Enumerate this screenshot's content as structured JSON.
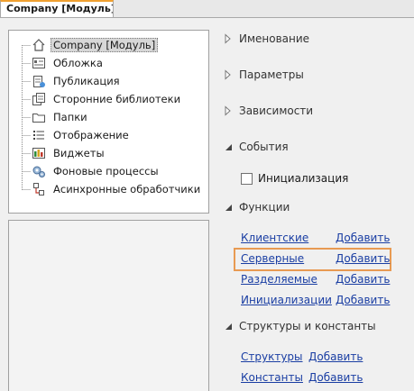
{
  "tab": {
    "label": "Company [Модуль]"
  },
  "tree": {
    "items": [
      {
        "label": "Company [Модуль]",
        "icon": "home-icon"
      },
      {
        "label": "Обложка",
        "icon": "cover-icon"
      },
      {
        "label": "Публикация",
        "icon": "publication-icon"
      },
      {
        "label": "Сторонние библиотеки",
        "icon": "libraries-icon"
      },
      {
        "label": "Папки",
        "icon": "folder-icon"
      },
      {
        "label": "Отображение",
        "icon": "list-icon"
      },
      {
        "label": "Виджеты",
        "icon": "widgets-icon"
      },
      {
        "label": "Фоновые процессы",
        "icon": "gears-icon"
      },
      {
        "label": "Асинхронные обработчики",
        "icon": "async-handlers-icon"
      }
    ]
  },
  "sections": {
    "naming": "Именование",
    "parameters": "Параметры",
    "dependencies": "Зависимости",
    "events": "События",
    "functions": "Функции",
    "structures": "Структуры и константы"
  },
  "events": {
    "initialization_label": "Инициализация"
  },
  "functions": {
    "rows": [
      {
        "name": "Клиентские",
        "add": "Добавить"
      },
      {
        "name": "Серверные",
        "add": "Добавить"
      },
      {
        "name": "Разделяемые",
        "add": "Добавить"
      },
      {
        "name": "Инициализации",
        "add": "Добавить"
      }
    ]
  },
  "structures": {
    "rows": [
      {
        "name": "Структуры",
        "add": "Добавить"
      },
      {
        "name": "Константы",
        "add": "Добавить"
      }
    ]
  },
  "colors": {
    "highlight": "#e89a52",
    "link": "#1a3ea3",
    "tab_accent": "#f0a030"
  }
}
